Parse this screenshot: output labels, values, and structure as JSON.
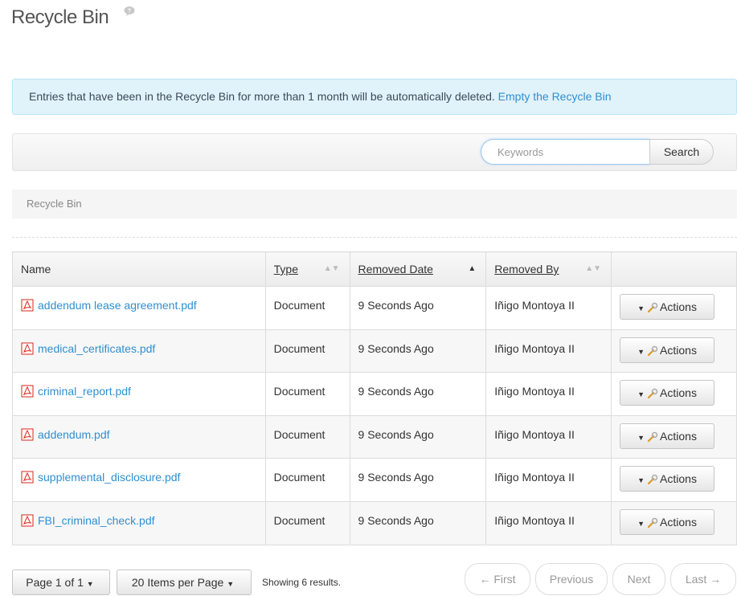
{
  "header": {
    "title": "Recycle Bin"
  },
  "alert": {
    "message": "Entries that have been in the Recycle Bin for more than 1 month will be automatically deleted.",
    "link": "Empty the Recycle Bin"
  },
  "search": {
    "placeholder": "Keywords",
    "button": "Search"
  },
  "breadcrumb": "Recycle Bin",
  "table": {
    "columns": [
      "Name",
      "Type",
      "Removed Date",
      "Removed By"
    ],
    "sort_column": "Removed Date",
    "sort_direction": "ascending",
    "rows": [
      {
        "name": "addendum lease agreement.pdf",
        "type": "Document",
        "removed_date": "9 Seconds Ago",
        "removed_by": "Iñigo Montoya II",
        "action": "Actions"
      },
      {
        "name": "medical_certificates.pdf",
        "type": "Document",
        "removed_date": "9 Seconds Ago",
        "removed_by": "Iñigo Montoya II",
        "action": "Actions"
      },
      {
        "name": "criminal_report.pdf",
        "type": "Document",
        "removed_date": "9 Seconds Ago",
        "removed_by": "Iñigo Montoya II",
        "action": "Actions"
      },
      {
        "name": "addendum.pdf",
        "type": "Document",
        "removed_date": "9 Seconds Ago",
        "removed_by": "Iñigo Montoya II",
        "action": "Actions"
      },
      {
        "name": "supplemental_disclosure.pdf",
        "type": "Document",
        "removed_date": "9 Seconds Ago",
        "removed_by": "Iñigo Montoya II",
        "action": "Actions"
      },
      {
        "name": "FBI_criminal_check.pdf",
        "type": "Document",
        "removed_date": "9 Seconds Ago",
        "removed_by": "Iñigo Montoya II",
        "action": "Actions"
      }
    ]
  },
  "pagination": {
    "page_label": "Page 1 of 1",
    "per_page_label": "20 Items per Page",
    "results": "Showing 6 results.",
    "first": "← First",
    "previous": "Previous",
    "next": "Next",
    "last": "Last →"
  },
  "icons": {
    "help": "help-bubble-icon",
    "file": "pdf-icon",
    "actions": "wrench-icon",
    "dropdown": "caret-down-icon"
  },
  "colors": {
    "link": "#2f8fd0",
    "alert_bg": "#e0f2fa",
    "pdf_red": "#d9261c"
  }
}
